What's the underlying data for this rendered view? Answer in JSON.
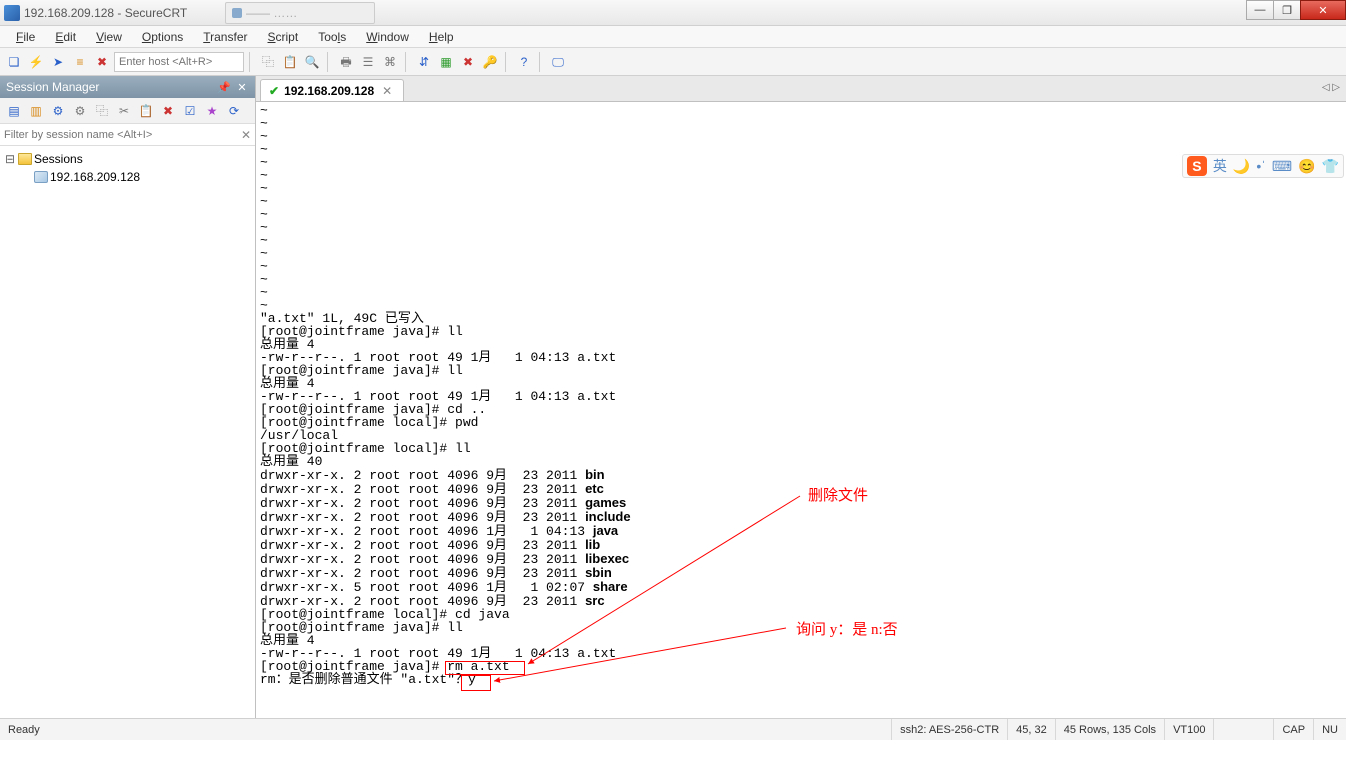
{
  "window": {
    "title": "192.168.209.128 - SecureCRT",
    "bg_tab": "——  ……"
  },
  "menu": {
    "file": "File",
    "edit": "Edit",
    "view": "View",
    "options": "Options",
    "transfer": "Transfer",
    "script": "Script",
    "tools": "Tools",
    "window": "Window",
    "help": "Help"
  },
  "toolbar": {
    "host_placeholder": "Enter host <Alt+R>"
  },
  "session_manager": {
    "title": "Session Manager",
    "filter_placeholder": "Filter by session name <Alt+I>",
    "root": "Sessions",
    "items": [
      "192.168.209.128"
    ]
  },
  "tab": {
    "label": "192.168.209.128"
  },
  "terminal": {
    "lines": [
      "~",
      "~",
      "~",
      "~",
      "~",
      "~",
      "~",
      "~",
      "~",
      "~",
      "~",
      "~",
      "~",
      "~",
      "~",
      "~",
      "\"a.txt\" 1L, 49C 已写入",
      "[root@jointframe java]# ll",
      "总用量 4",
      "-rw-r--r--. 1 root root 49 1月   1 04:13 a.txt",
      "[root@jointframe java]# ll",
      "总用量 4",
      "-rw-r--r--. 1 root root 49 1月   1 04:13 a.txt",
      "[root@jointframe java]# cd ..",
      "[root@jointframe local]# pwd",
      "/usr/local",
      "[root@jointframe local]# ll",
      "总用量 40"
    ],
    "ls": [
      {
        "perm": "drwxr-xr-x. 2 root root 4096 9月  23 2011 ",
        "name": "bin"
      },
      {
        "perm": "drwxr-xr-x. 2 root root 4096 9月  23 2011 ",
        "name": "etc"
      },
      {
        "perm": "drwxr-xr-x. 2 root root 4096 9月  23 2011 ",
        "name": "games"
      },
      {
        "perm": "drwxr-xr-x. 2 root root 4096 9月  23 2011 ",
        "name": "include"
      },
      {
        "perm": "drwxr-xr-x. 2 root root 4096 1月   1 04:13 ",
        "name": "java"
      },
      {
        "perm": "drwxr-xr-x. 2 root root 4096 9月  23 2011 ",
        "name": "lib"
      },
      {
        "perm": "drwxr-xr-x. 2 root root 4096 9月  23 2011 ",
        "name": "libexec"
      },
      {
        "perm": "drwxr-xr-x. 2 root root 4096 9月  23 2011 ",
        "name": "sbin"
      },
      {
        "perm": "drwxr-xr-x. 5 root root 4096 1月   1 02:07 ",
        "name": "share"
      },
      {
        "perm": "drwxr-xr-x. 2 root root 4096 9月  23 2011 ",
        "name": "src"
      }
    ],
    "tail": [
      "[root@jointframe local]# cd java",
      "[root@jointframe java]# ll",
      "总用量 4",
      "-rw-r--r--. 1 root root 49 1月   1 04:13 a.txt",
      "[root@jointframe java]# rm a.txt",
      "rm：是否删除普通文件 \"a.txt\"？y"
    ]
  },
  "annotations": {
    "a1": "删除文件",
    "a2": "询问 y：是  n:否"
  },
  "ime": {
    "lang": "英"
  },
  "status": {
    "ready": "Ready",
    "ssh": "ssh2: AES-256-CTR",
    "pos": "45,  32",
    "size": "45 Rows, 135 Cols",
    "term": "VT100",
    "cap": "CAP",
    "num": "NU"
  }
}
